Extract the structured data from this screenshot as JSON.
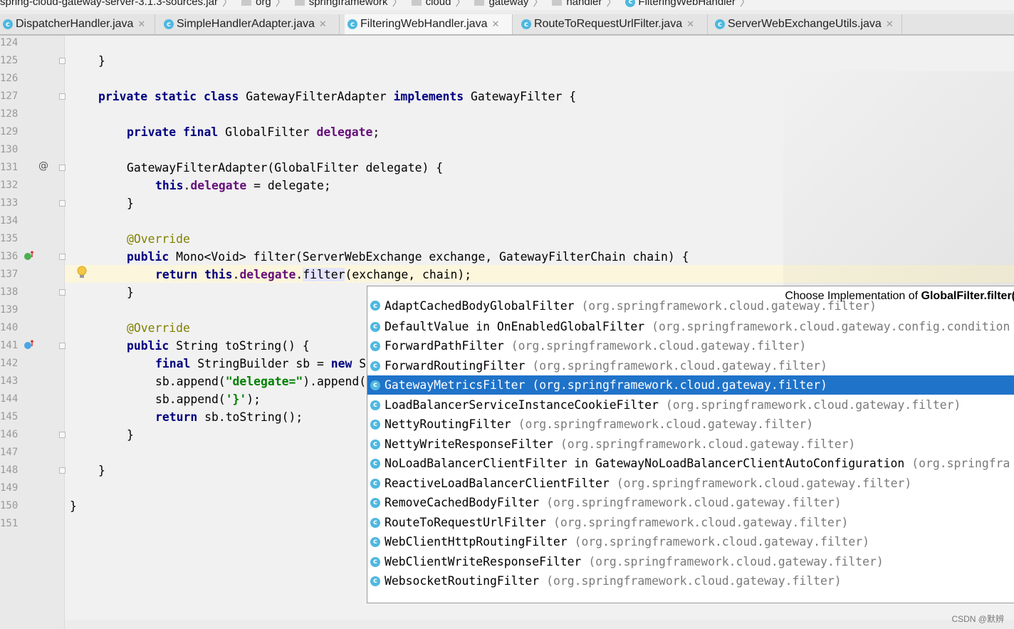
{
  "breadcrumb": {
    "items": [
      "spring-cloud-gateway-server-3.1.3-sources.jar",
      "org",
      "springframework",
      "cloud",
      "gateway",
      "handler",
      "FilteringWebHandler"
    ]
  },
  "tabs": [
    {
      "label": "DispatcherHandler.java",
      "active": false
    },
    {
      "label": "SimpleHandlerAdapter.java",
      "active": false
    },
    {
      "label": "FilteringWebHandler.java",
      "active": true
    },
    {
      "label": "RouteToRequestUrlFilter.java",
      "active": false
    },
    {
      "label": "ServerWebExchangeUtils.java",
      "active": false
    }
  ],
  "editor": {
    "line_numbers": [
      "124",
      "125",
      "126",
      "127",
      "128",
      "129",
      "130",
      "131",
      "132",
      "133",
      "134",
      "135",
      "136",
      "137",
      "138",
      "139",
      "140",
      "141",
      "142",
      "143",
      "144",
      "145",
      "146",
      "147",
      "148",
      "149",
      "150",
      "151"
    ],
    "code": {
      "l125": "}",
      "l127_kw": "private static class",
      "l127_name": " GatewayFilterAdapter ",
      "l127_impl": "implements",
      "l127_rest": " GatewayFilter {",
      "l129_kw": "private final",
      "l129_type": " GlobalFilter ",
      "l129_field": "delegate",
      "l129_end": ";",
      "l131": "GatewayFilterAdapter(GlobalFilter delegate) {",
      "l132_kw": "this",
      "l132_dot": ".",
      "l132_field": "delegate",
      "l132_rest": " = delegate;",
      "l133": "}",
      "l135": "@Override",
      "l136_kw": "public",
      "l136_rest": " Mono<Void> filter(ServerWebExchange exchange, GatewayFilterChain chain) {",
      "l137_kw": "return this",
      "l137_dot": ".",
      "l137_field": "delegate",
      "l137_dot2": ".",
      "l137_method": "filter",
      "l137_rest": "(exchange, chain);",
      "l138": "}",
      "l140": "@Override",
      "l141_kw": "public",
      "l141_rest": " String toString() {",
      "l142_kw": "final",
      "l142_rest": " StringBuilder sb = ",
      "l142_new": "new",
      "l142_tail": " S",
      "l143_a": "sb.append(",
      "l143_str": "\"delegate=\"",
      "l143_b": ").append(",
      "l144_a": "sb.append(",
      "l144_str": "'}'",
      "l144_b": ");",
      "l145_kw": "return",
      "l145_rest": " sb.toString();",
      "l146": "}",
      "l148": "}",
      "l150": "}"
    },
    "gutter_at": "@"
  },
  "popup": {
    "title_prefix": "Choose Implementation of ",
    "title_bold": "GlobalFilter.filter(",
    "items": [
      {
        "name": "AdaptCachedBodyGlobalFilter",
        "pkg": "(org.springframework.cloud.gateway.filter)"
      },
      {
        "name": "DefaultValue in OnEnabledGlobalFilter",
        "pkg": "(org.springframework.cloud.gateway.config.condition"
      },
      {
        "name": "ForwardPathFilter",
        "pkg": "(org.springframework.cloud.gateway.filter)"
      },
      {
        "name": "ForwardRoutingFilter",
        "pkg": "(org.springframework.cloud.gateway.filter)"
      },
      {
        "name": "GatewayMetricsFilter",
        "pkg": "(org.springframework.cloud.gateway.filter)",
        "selected": true
      },
      {
        "name": "LoadBalancerServiceInstanceCookieFilter",
        "pkg": "(org.springframework.cloud.gateway.filter)"
      },
      {
        "name": "NettyRoutingFilter",
        "pkg": "(org.springframework.cloud.gateway.filter)"
      },
      {
        "name": "NettyWriteResponseFilter",
        "pkg": "(org.springframework.cloud.gateway.filter)"
      },
      {
        "name": "NoLoadBalancerClientFilter in GatewayNoLoadBalancerClientAutoConfiguration",
        "pkg": "(org.springfra"
      },
      {
        "name": "ReactiveLoadBalancerClientFilter",
        "pkg": "(org.springframework.cloud.gateway.filter)"
      },
      {
        "name": "RemoveCachedBodyFilter",
        "pkg": "(org.springframework.cloud.gateway.filter)"
      },
      {
        "name": "RouteToRequestUrlFilter",
        "pkg": "(org.springframework.cloud.gateway.filter)"
      },
      {
        "name": "WebClientHttpRoutingFilter",
        "pkg": "(org.springframework.cloud.gateway.filter)"
      },
      {
        "name": "WebClientWriteResponseFilter",
        "pkg": "(org.springframework.cloud.gateway.filter)"
      },
      {
        "name": "WebsocketRoutingFilter",
        "pkg": "(org.springframework.cloud.gateway.filter)"
      }
    ]
  },
  "watermark": "CSDN @默辨",
  "colors": {
    "selection": "#1f73c9",
    "class_icon": "#4fb8e0",
    "keyword": "#000080",
    "field": "#660e7a"
  }
}
